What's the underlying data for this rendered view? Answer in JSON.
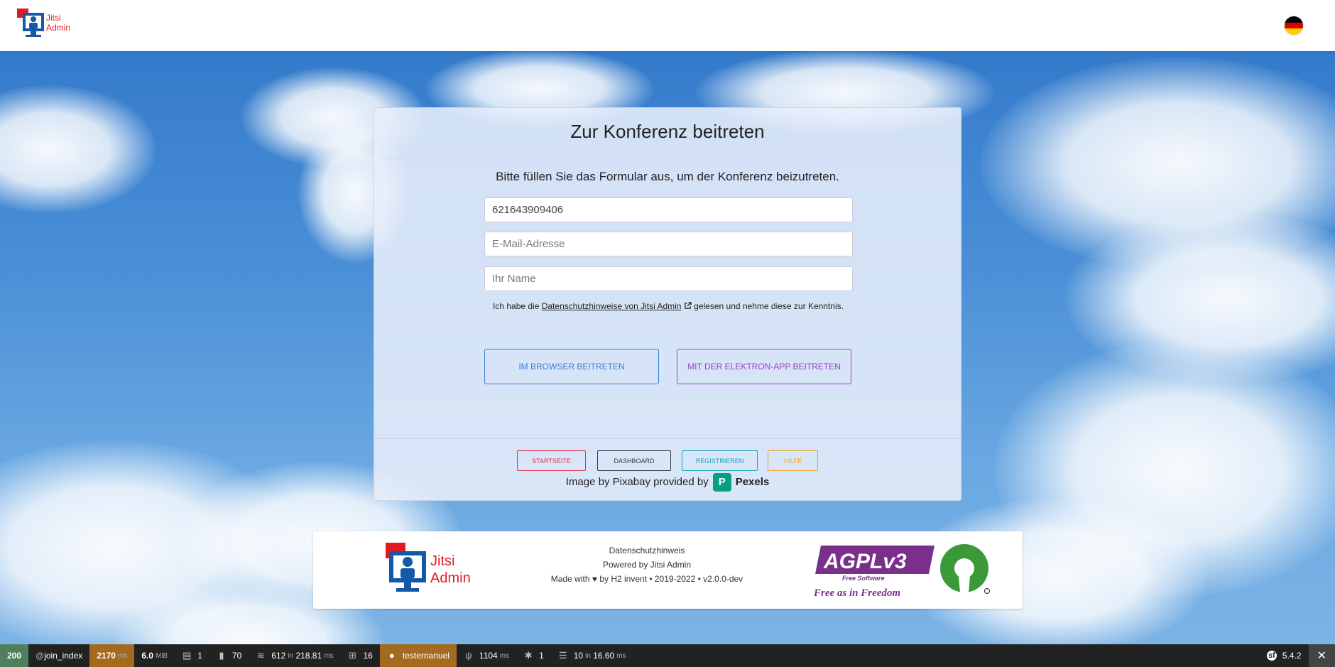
{
  "header": {
    "logo_line1": "Jitsi",
    "logo_line2": "Admin",
    "language_icon": "german-flag-icon"
  },
  "card": {
    "title": "Zur Konferenz beitreten",
    "subtitle": "Bitte füllen Sie das Formular aus, um der Konferenz beizutreten.",
    "conference_id_value": "621643909406",
    "email_placeholder": "E-Mail-Adresse",
    "name_placeholder": "Ihr Name",
    "consent_prefix": "Ich habe die ",
    "consent_link": "Datenschutzhinweise von Jitsi Admin",
    "consent_suffix": " gelesen und nehme diese zur Kenntnis.",
    "btn_browser": "Im Browser beitreten",
    "btn_app": "Mit der Elektron-App beitreten"
  },
  "card_footer": {
    "buttons": [
      {
        "label": "Startseite",
        "color": "#dc3545"
      },
      {
        "label": "Dashboard",
        "color": "#343a40"
      },
      {
        "label": "Registrieren",
        "color": "#17a2b8"
      },
      {
        "label": "Hilfe",
        "color": "#f0a030"
      }
    ],
    "credit_text": "Image by Pixabay provided by",
    "credit_brand": "Pexels"
  },
  "footer": {
    "logo_line1": "Jitsi",
    "logo_line2": "Admin",
    "privacy": "Datenschutzhinweis",
    "powered": "Powered by Jitsi Admin",
    "made_prefix": "Made with",
    "made_suffix": "by H2 invent • 2019-2022 • v2.0.0-dev",
    "agpl_text": "AGPLv3",
    "agpl_sub": "Free Software",
    "agpl_tagline": "Free as in Freedom"
  },
  "debugbar": {
    "status": "200",
    "route": "join_index",
    "time": "2170",
    "time_unit": "ms",
    "memory": "6.0",
    "memory_unit": "MiB",
    "forms": "1",
    "validator": "70",
    "cache_count": "612",
    "cache_in": "in",
    "cache_time": "218.81",
    "cache_unit": "ms",
    "translations": "16",
    "user": "testernanuel",
    "render_time": "1104",
    "render_unit": "ms",
    "events": "1",
    "db_count": "10",
    "db_in": "in",
    "db_time": "16.60",
    "db_unit": "ms",
    "symfony_version": "5.4.2",
    "colors": {
      "status": "#4f805d",
      "time": "#a46a1f",
      "user": "#a46a1f"
    }
  }
}
